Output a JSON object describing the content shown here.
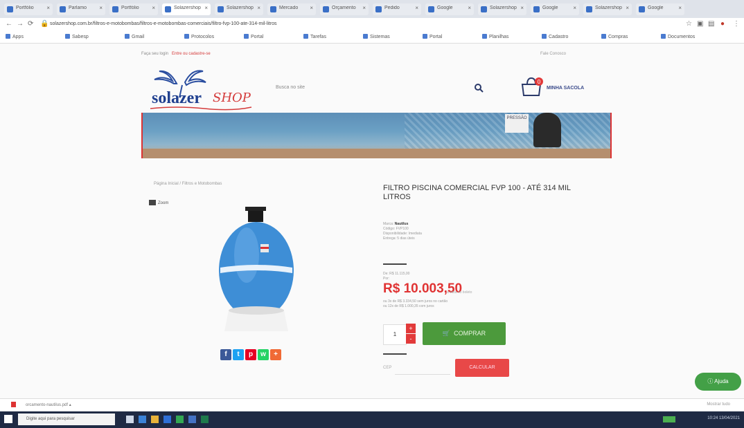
{
  "browser": {
    "tabs": [
      {
        "title": "Portfólio",
        "active": false
      },
      {
        "title": "Parlamo",
        "active": false
      },
      {
        "title": "Portfólio",
        "active": false
      },
      {
        "title": "Solazershop",
        "active": true
      },
      {
        "title": "Solazershop",
        "active": false
      },
      {
        "title": "Mercado",
        "active": false
      },
      {
        "title": "Orçamento",
        "active": false
      },
      {
        "title": "Pedido",
        "active": false
      },
      {
        "title": "Google",
        "active": false
      },
      {
        "title": "Solazershop",
        "active": false
      },
      {
        "title": "Google",
        "active": false
      },
      {
        "title": "Solazershop",
        "active": false
      },
      {
        "title": "Google",
        "active": false
      }
    ],
    "url": "solazershop.com.br/filtros-e-motobombas/filtros-e-motobombas-comerciais/filtro-fvp-100-ate-314-mil-litros",
    "bookmarks": [
      "Apps",
      "Sabesp",
      "Gmail",
      "Protocolos",
      "Portal",
      "Tarefas",
      "Sistemas",
      "Portal",
      "Planilhas",
      "Cadastro",
      "Compras",
      "Documentos"
    ]
  },
  "store": {
    "toplinks_left": "Faça seu login",
    "toplinks_red": "Entre ou cadastre-se",
    "toplinks_right": "Fale Conosco",
    "logo_text": "solazer",
    "logo_script": "SHOP",
    "search_placeholder": "Busca no site",
    "bag_label": "MINHA SACOLA",
    "bag_count": "0",
    "banner_sign": "PRESSÃO"
  },
  "product": {
    "breadcrumb": "Página Inicial / Filtros e Motobombas",
    "zoom_label": "Zoom",
    "title": "FILTRO PISCINA COMERCIAL FVP 100 - ATÉ 314 MIL LITROS",
    "meta_brand_label": "Marca:",
    "meta_brand": "Nautilus",
    "meta_lines": [
      "Código: FVP100",
      "Disponibilidade: Imediata",
      "Entrega: 5 dias úteis"
    ],
    "price_small": [
      "De: R$ 11.115,00",
      "Por:"
    ],
    "price": "R$ 10.003,50",
    "price_note": "à vista no boleto",
    "installments": [
      "ou 3x de R$ 3.334,50 sem juros no cartão",
      "ou 12x de R$ 1.000,35 com juros"
    ],
    "qty": "1",
    "qty_up": "+",
    "qty_down": "-",
    "buy_label": "COMPRAR",
    "frete_label": "CEP",
    "calc_label": "CALCULAR",
    "share": [
      "f",
      "t",
      "p",
      "w",
      "+"
    ],
    "share_colors": [
      "#3b5998",
      "#1da1f2",
      "#e60023",
      "#25d366",
      "#f06a35"
    ]
  },
  "help_label": "Ajuda",
  "downloads": {
    "file": "orcamento-nautilus.pdf",
    "show_all": "Mostrar tudo"
  },
  "taskbar": {
    "search": "Digite aqui para pesquisar",
    "tray": "10:24  13/04/2021"
  }
}
